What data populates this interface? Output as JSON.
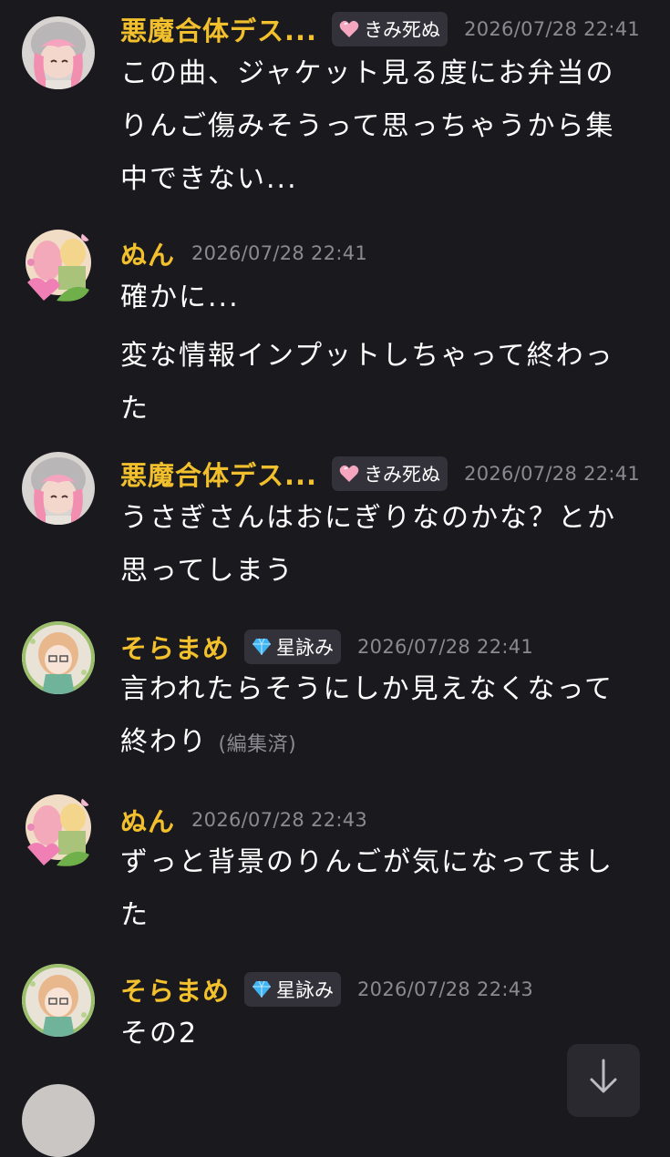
{
  "colors": {
    "background": "#1a191e",
    "username": "#f2c02c",
    "timestamp": "#8b8a91",
    "badge_bg": "#33323a"
  },
  "messages": [
    {
      "user": "悪魔合体デス...",
      "badge": {
        "icon": "pink-heart-icon",
        "label": "きみ死ぬ"
      },
      "time": "2026/07/28 22:41",
      "lines": [
        "この曲、ジャケット見る度にお弁当のりんご傷みそうって思っちゃうから集中できない..."
      ]
    },
    {
      "user": "ぬん",
      "time": "2026/07/28 22:41",
      "lines": [
        "確かに...",
        "変な情報インプットしちゃって終わった"
      ]
    },
    {
      "user": "悪魔合体デス...",
      "badge": {
        "icon": "pink-heart-icon",
        "label": "きみ死ぬ"
      },
      "time": "2026/07/28 22:41",
      "lines": [
        "うさぎさんはおにぎりなのかな？とか思ってしまう"
      ]
    },
    {
      "user": "そらまめ",
      "badge": {
        "icon": "blue-diamond-icon",
        "label": "星詠み"
      },
      "time": "2026/07/28 22:41",
      "lines": [
        "言われたらそうにしか見えなくなって終わり"
      ],
      "edited": "(編集済)"
    },
    {
      "user": "ぬん",
      "time": "2026/07/28 22:43",
      "lines": [
        "ずっと背景のりんごが気になってました"
      ]
    },
    {
      "user": "そらまめ",
      "badge": {
        "icon": "blue-diamond-icon",
        "label": "星詠み"
      },
      "time": "2026/07/28 22:43",
      "lines": [
        "その2"
      ]
    }
  ],
  "scroll_button": {
    "icon": "arrow-down-icon"
  }
}
